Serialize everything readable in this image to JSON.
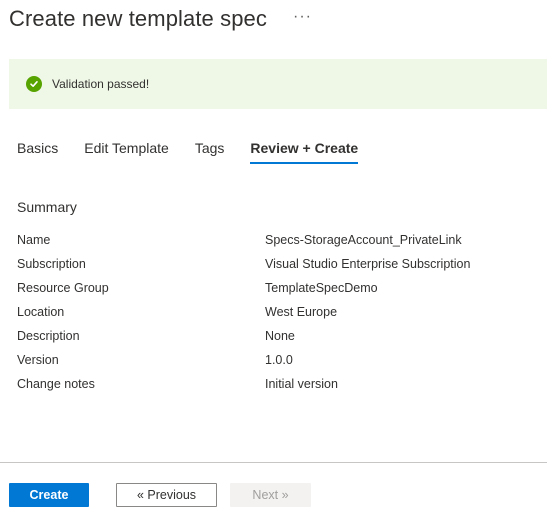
{
  "header": {
    "title": "Create new template spec",
    "more_label": "···"
  },
  "banner": {
    "text": "Validation passed!",
    "status_color": "#57a300"
  },
  "tabs": [
    {
      "label": "Basics",
      "active": false
    },
    {
      "label": "Edit Template",
      "active": false
    },
    {
      "label": "Tags",
      "active": false
    },
    {
      "label": "Review + Create",
      "active": true
    }
  ],
  "summary": {
    "title": "Summary",
    "rows": [
      {
        "key": "Name",
        "value": "Specs-StorageAccount_PrivateLink"
      },
      {
        "key": "Subscription",
        "value": "Visual Studio Enterprise Subscription"
      },
      {
        "key": "Resource Group",
        "value": "TemplateSpecDemo"
      },
      {
        "key": "Location",
        "value": "West Europe"
      },
      {
        "key": "Description",
        "value": "None"
      },
      {
        "key": "Version",
        "value": "1.0.0"
      },
      {
        "key": "Change notes",
        "value": "Initial version"
      }
    ]
  },
  "footer": {
    "create_label": "Create",
    "previous_label": "« Previous",
    "next_label": "Next »",
    "accent": "#0078d4"
  }
}
